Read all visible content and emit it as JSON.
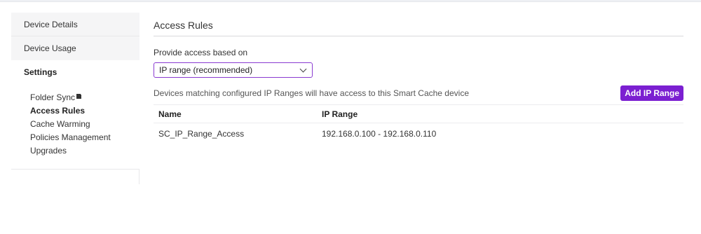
{
  "sidebar": {
    "items": [
      {
        "label": "Device Details"
      },
      {
        "label": "Device Usage"
      },
      {
        "label": "Settings"
      }
    ],
    "sub_items": [
      {
        "label": "Folder Sync",
        "icon": "external-link-icon"
      },
      {
        "label": "Access Rules"
      },
      {
        "label": "Cache Warming"
      },
      {
        "label": "Policies Management"
      },
      {
        "label": "Upgrades"
      }
    ]
  },
  "main": {
    "title": "Access Rules",
    "access_label": "Provide access based on",
    "select_value": "IP range (recommended)",
    "info_text": "Devices matching configured IP Ranges will have access to this Smart Cache device",
    "add_button_label": "Add IP Range",
    "accent_color": "#7b1fd1"
  },
  "table": {
    "columns": [
      "Name",
      "IP Range"
    ],
    "rows": [
      [
        "SC_IP_Range_Access",
        "192.168.0.100 - 192.168.0.110"
      ]
    ]
  }
}
